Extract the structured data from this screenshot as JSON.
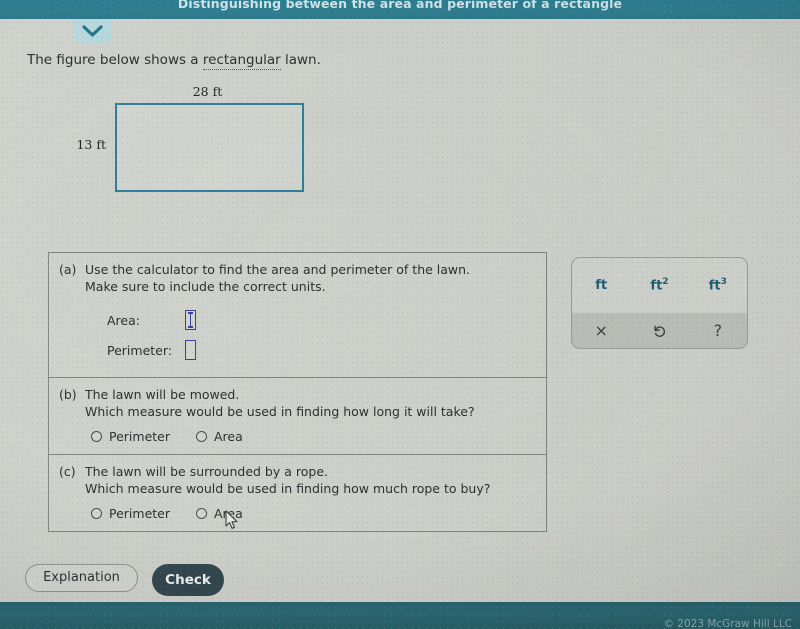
{
  "header": {
    "title": "Distinguishing between the area and perimeter of a rectangle",
    "collapse_icon": "chevron-down-icon",
    "bar_color": "#2f7f90"
  },
  "prompt": {
    "before": "The figure below shows a ",
    "term": "rectangular",
    "after": " lawn."
  },
  "figure": {
    "top_label": "28 ft",
    "left_label": "13 ft",
    "border_color": "#2f7f9c"
  },
  "questions": [
    {
      "label": "(a)",
      "line1": "Use the calculator to find the area and perimeter of the lawn.",
      "line2": "Make sure to include the correct units.",
      "fields": [
        {
          "caption": "Area:",
          "value": "",
          "focused": true
        },
        {
          "caption": "Perimeter:",
          "value": "",
          "focused": false
        }
      ]
    },
    {
      "label": "(b)",
      "line1": "The lawn will be mowed.",
      "line2": "Which measure would be used in finding how long it will take?",
      "choices": [
        {
          "label": "Perimeter",
          "selected": false
        },
        {
          "label": "Area",
          "selected": false
        }
      ]
    },
    {
      "label": "(c)",
      "line1": "The lawn will be surrounded by a rope.",
      "line2": "Which measure would be used in finding how much rope to buy?",
      "choices": [
        {
          "label": "Perimeter",
          "selected": false
        },
        {
          "label": "Area",
          "selected": false
        }
      ]
    }
  ],
  "keypad": {
    "units": [
      {
        "base": "ft",
        "exp": ""
      },
      {
        "base": "ft",
        "exp": "2"
      },
      {
        "base": "ft",
        "exp": "3"
      }
    ],
    "tools": [
      {
        "name": "clear-icon",
        "glyph": "×"
      },
      {
        "name": "undo-icon",
        "glyph": "↺"
      },
      {
        "name": "help-icon",
        "glyph": "?"
      }
    ],
    "unit_color": "#1f5f72"
  },
  "actions": {
    "explanation_label": "Explanation",
    "check_label": "Check",
    "check_color": "#34474f"
  },
  "footer": {
    "copyright": "© 2023 McGraw Hill LLC",
    "bar_color": "#2c6b76"
  }
}
